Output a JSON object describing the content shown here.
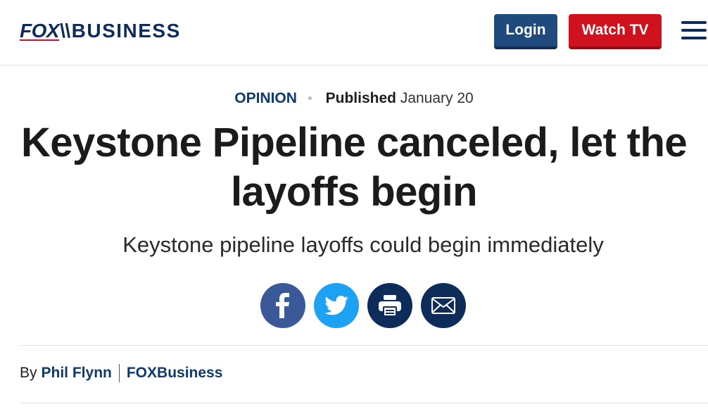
{
  "header": {
    "logo_fox": "FOX",
    "logo_business": "BUSINESS",
    "login_label": "Login",
    "watch_label": "Watch TV",
    "menu_icon": "hamburger-menu-icon"
  },
  "article": {
    "category": "OPINION",
    "published_label": "Published",
    "published_date": "January 20",
    "headline": "Keystone Pipeline canceled, let the layoffs begin",
    "subheadline": "Keystone pipeline layoffs could begin immediately",
    "share_icons": [
      "facebook-icon",
      "twitter-icon",
      "print-icon",
      "email-icon"
    ],
    "byline_prefix": "By",
    "author": "Phil Flynn",
    "source": "FOXBusiness"
  },
  "colors": {
    "brand_navy": "#0e2c59",
    "login_blue": "#1e4a7e",
    "watch_red": "#d0121e",
    "facebook": "#3b5998",
    "twitter": "#1da1f2"
  }
}
